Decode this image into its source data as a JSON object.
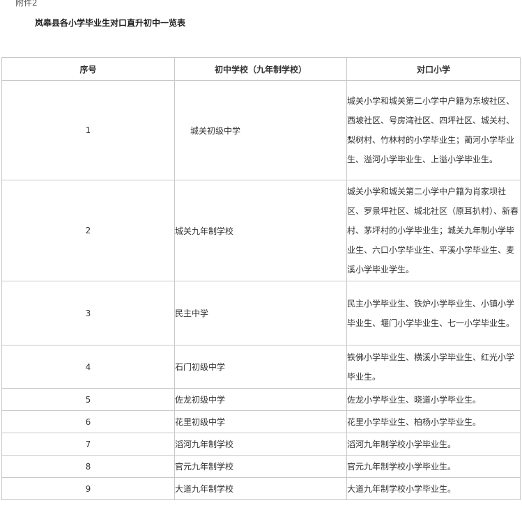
{
  "header": {
    "attachment": "附件2",
    "title": "岚皋县各小学毕业生对口直升初中一览表"
  },
  "table": {
    "columns": [
      "序号",
      "初中学校（九年制学校）",
      "对口小学"
    ],
    "rows": [
      {
        "no": "1",
        "school": "城关初级中学",
        "feeders": "城关小学和城关第二小学中户籍为东坡社区、西坡社区、号房湾社区、四坪社区、城关村、梨树村、竹林村的小学毕业生；蔺河小学毕业生、溢河小学毕业生、上溢小学毕业生。"
      },
      {
        "no": "2",
        "school": "城关九年制学校",
        "feeders": "城关小学和城关第二小学中户籍为肖家坝社区、罗景坪社区、城北社区（原耳扒村）、新春村、茅坪村的小学毕业生；城关九年制小学毕业生、六口小学毕业生、平溪小学毕业生、麦溪小学毕业学生。"
      },
      {
        "no": "3",
        "school": "民主中学",
        "feeders": "民主小学毕业生、铁炉小学毕业生、小镇小学毕业生、堰门小学毕业生、七一小学毕业生。"
      },
      {
        "no": "4",
        "school": "石门初级中学",
        "feeders": "铁佛小学毕业生、横溪小学毕业生、红光小学毕业生。"
      },
      {
        "no": "5",
        "school": "佐龙初级中学",
        "feeders": "佐龙小学毕业生、晓道小学毕业生。"
      },
      {
        "no": "6",
        "school": "花里初级中学",
        "feeders": "花里小学毕业生、柏杨小学毕业生。"
      },
      {
        "no": "7",
        "school": "滔河九年制学校",
        "feeders": "滔河九年制学校小学毕业生。"
      },
      {
        "no": "8",
        "school": "官元九年制学校",
        "feeders": "官元九年制学校小学毕业生。"
      },
      {
        "no": "9",
        "school": "大道九年制学校",
        "feeders": "大道九年制学校小学毕业生。"
      }
    ]
  }
}
